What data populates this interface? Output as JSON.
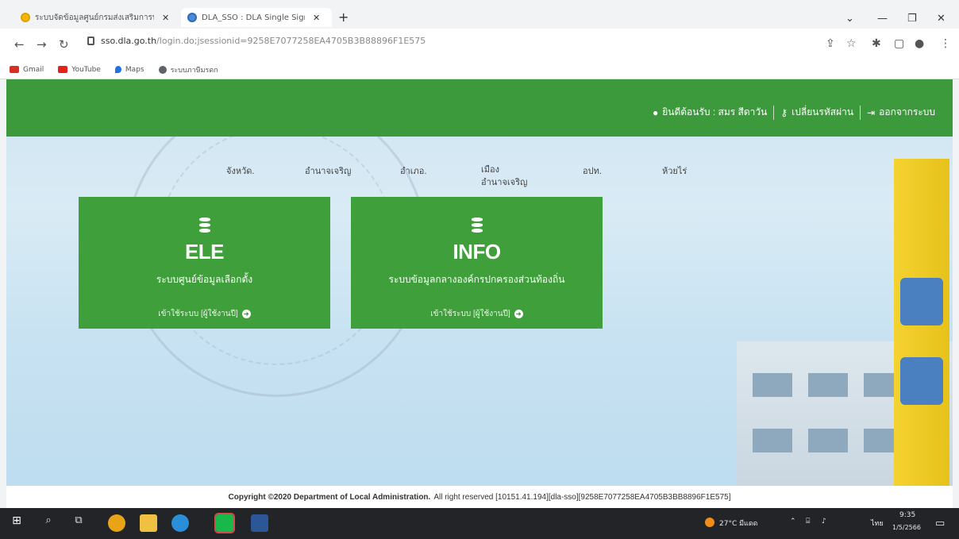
{
  "browser": {
    "tabs": [
      {
        "label": "ระบบจัดข้อมูลศูนย์กรมส่งเสริมการปกครอง"
      },
      {
        "label": "DLA_SSO : DLA Single Sign-c"
      }
    ],
    "url_host": "sso.dla.go.th",
    "url_path": "/login.do;jsessionid=9258E7077258EA4705B3B88896F1E575",
    "bookmarks": [
      {
        "label": "Gmail",
        "color": "#d93025"
      },
      {
        "label": "YouTube",
        "color": "#e62117"
      },
      {
        "label": "Maps",
        "color": "#1a73e8"
      },
      {
        "label": "ระบบภาษีมรดก",
        "color": "#5f6368"
      }
    ]
  },
  "header": {
    "welcome": "ยินดีต้อนรับ : สมร สีดาวัน",
    "change_password": "เปลี่ยนรหัสผ่าน",
    "logout": "ออกจากระบบ",
    "color": "#3c9a3c"
  },
  "location": {
    "province": "จังหวัด.",
    "province_value": "อำนาจเจริญ",
    "district": "อำเภอ.",
    "district_value": "เมือง อำนาจเจริญ",
    "org": "อปท.",
    "org_value": "ห้วยไร่"
  },
  "cards": [
    {
      "code": "ELE",
      "title": "ระบบศูนย์ข้อมูลเลือกตั้ง",
      "enter": "เข้าใช้ระบบ [ผู้ใช้งานปี]"
    },
    {
      "code": "INFO",
      "title": "ระบบข้อมูลกลางองค์กรปกครองส่วนท้องถิ่น",
      "enter": "เข้าใช้ระบบ [ผู้ใช้งานปี]"
    }
  ],
  "footer": {
    "copyright": "Copyright ©2020 Department of Local Administration.",
    "rights": "All right reserved [10151.41.194][dla-sso][9258E7077258EA4705B3BB8896F1E575]"
  },
  "taskbar": {
    "weather": "27°C มีแดด",
    "lang": "ไทย",
    "time": "9:35",
    "date": "1/5/2566"
  }
}
